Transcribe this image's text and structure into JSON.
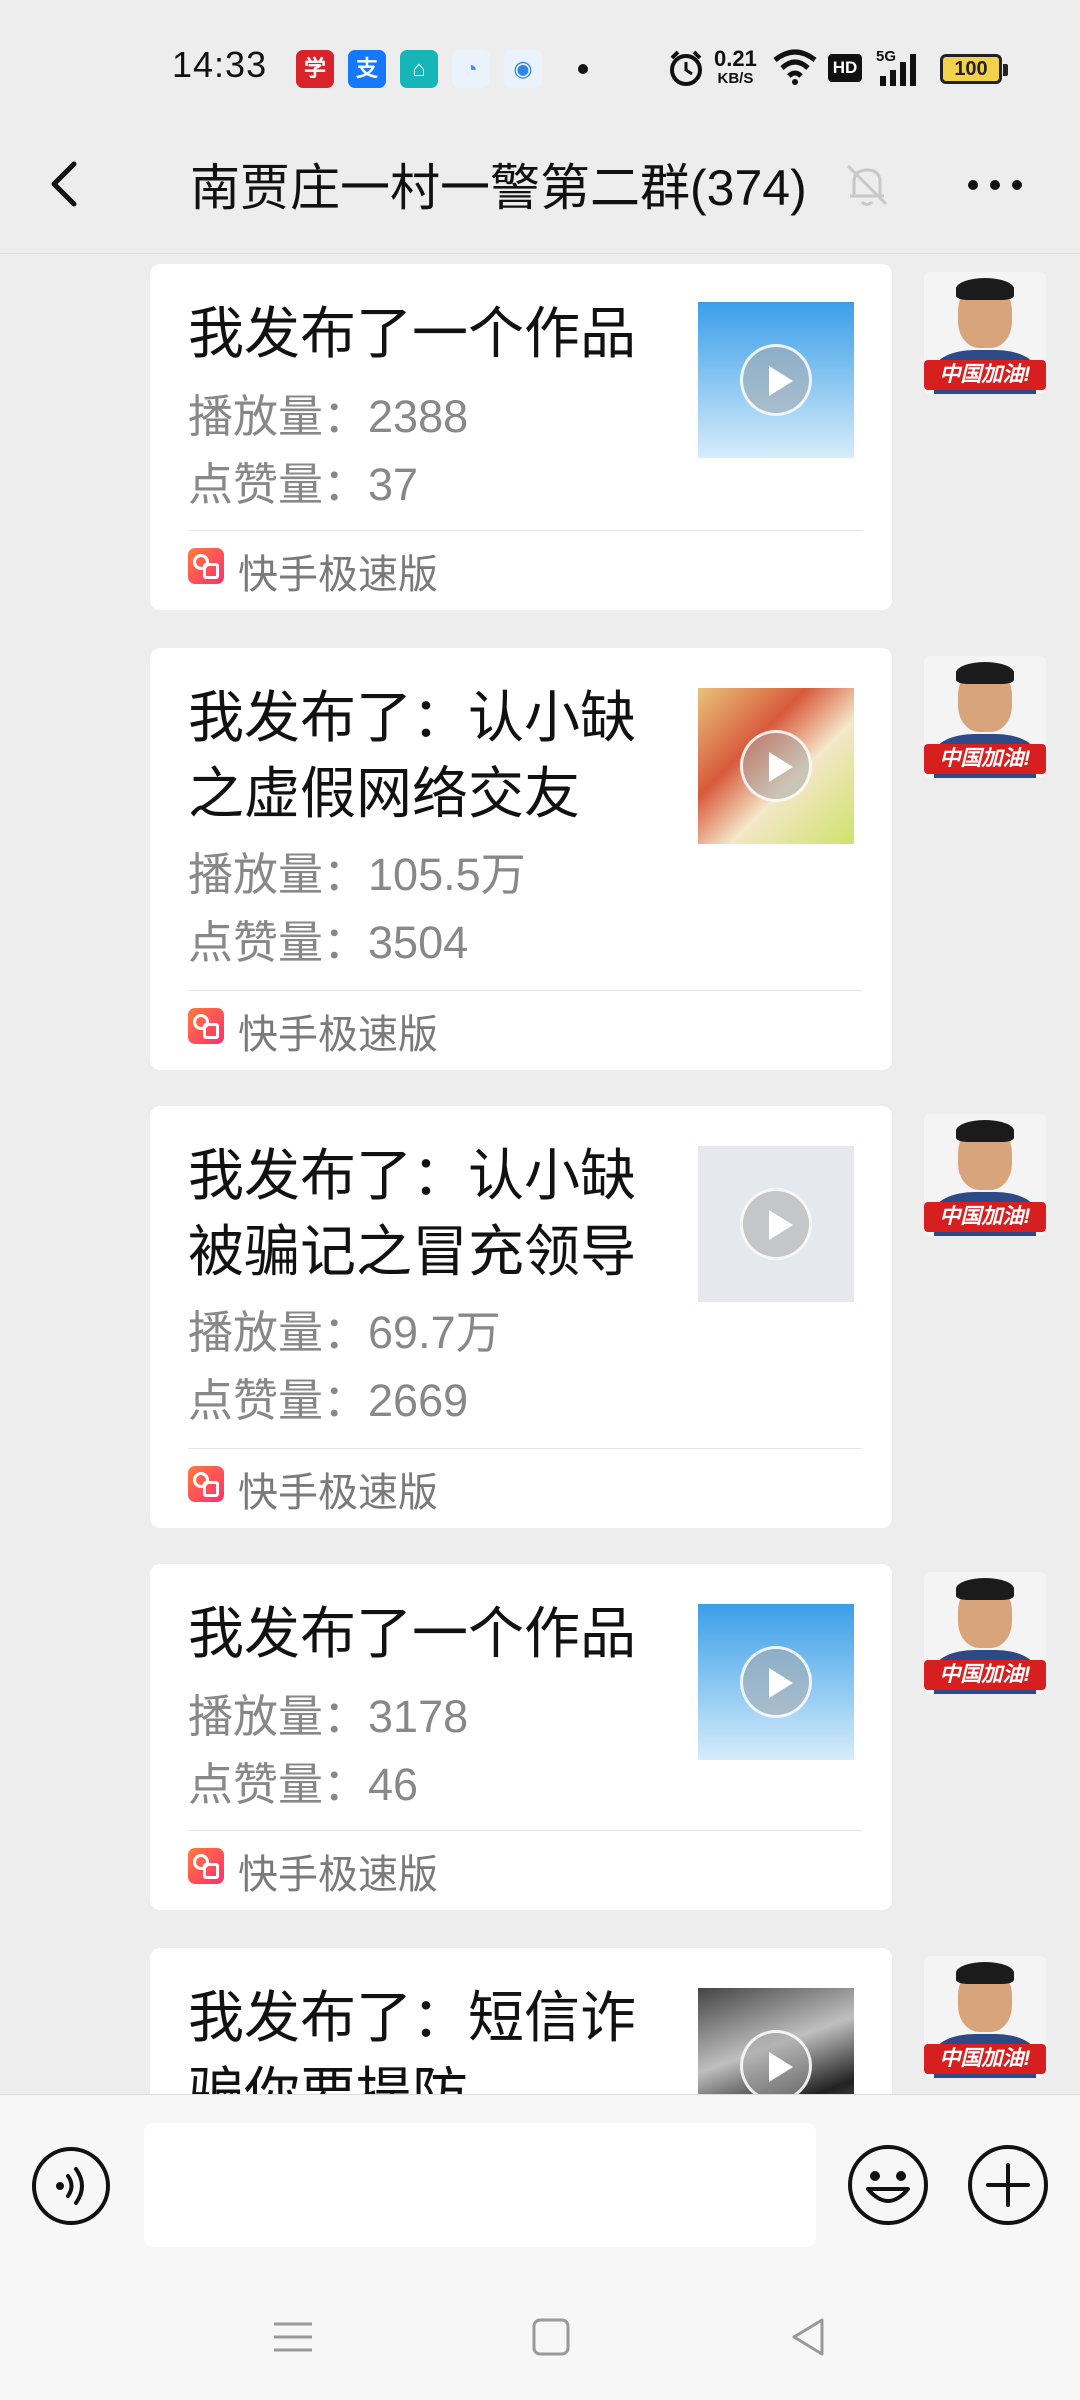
{
  "status_bar": {
    "time": "14:33",
    "net_speed_value": "0.21",
    "net_speed_unit": "KB/S",
    "hd": "HD",
    "signal": "5G",
    "battery": "100",
    "apps": [
      {
        "icon": "xuexi-app-icon",
        "glyph": "学",
        "color": "#d8232a"
      },
      {
        "icon": "alipay-app-icon",
        "glyph": "支",
        "color": "#1677ff"
      },
      {
        "icon": "home-app-icon",
        "glyph": "⌂",
        "color": "#16b6b8"
      },
      {
        "icon": "browser-app-icon",
        "glyph": "◔",
        "color": "#3d8ef7"
      },
      {
        "icon": "circle-app-icon",
        "glyph": "◉",
        "color": "#2f86e8"
      }
    ]
  },
  "header": {
    "title": "南贾庄一村一警第二群(374)"
  },
  "messages": [
    {
      "title": "我发布了一个作品",
      "views_label": "播放量：",
      "views": "2388",
      "likes_label": "点赞量：",
      "likes": "37",
      "source": "快手极速版",
      "thumb": "blue"
    },
    {
      "title": "我发布了：认小缺之虚假网络交友",
      "views_label": "播放量：",
      "views": "105.5万",
      "likes_label": "点赞量：",
      "likes": "3504",
      "source": "快手极速版",
      "thumb": "photo1"
    },
    {
      "title": "我发布了：认小缺被骗记之冒充领导",
      "views_label": "播放量：",
      "views": "69.7万",
      "likes_label": "点赞量：",
      "likes": "2669",
      "source": "快手极速版",
      "thumb": "gray"
    },
    {
      "title": "我发布了一个作品",
      "views_label": "播放量：",
      "views": "3178",
      "likes_label": "点赞量：",
      "likes": "46",
      "source": "快手极速版",
      "thumb": "blue"
    },
    {
      "title": "我发布了：短信诈骗你要提防",
      "thumb": "photo2"
    }
  ],
  "avatar_banner": "中国加油!",
  "colors": {
    "background": "#ededed",
    "card": "#ffffff",
    "avatar_banner": "#d81f1f"
  }
}
